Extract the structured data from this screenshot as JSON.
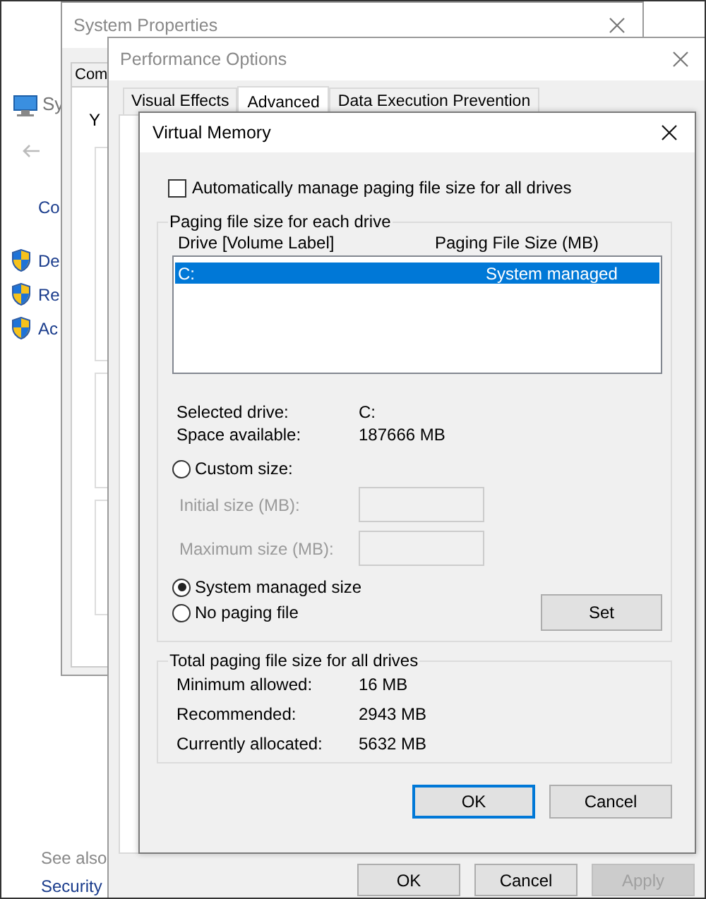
{
  "control_panel": {
    "header": "Sy",
    "link": "Co",
    "tasks": [
      {
        "label": "De"
      },
      {
        "label": "Re"
      },
      {
        "label": "Ac"
      }
    ],
    "see_also": "See also",
    "security": "Security"
  },
  "system_properties": {
    "title": "System Properties",
    "tab": "Com",
    "text": "Y"
  },
  "performance_options": {
    "title": "Performance Options",
    "tabs": [
      {
        "label": "Visual Effects",
        "selected": false
      },
      {
        "label": "Advanced",
        "selected": true
      },
      {
        "label": "Data Execution Prevention",
        "selected": false
      }
    ],
    "buttons": [
      {
        "label": "OK",
        "disabled": false
      },
      {
        "label": "Cancel",
        "disabled": false
      },
      {
        "label": "Apply",
        "disabled": true
      }
    ]
  },
  "virtual_memory": {
    "title": "Virtual Memory",
    "auto_manage": {
      "label": "Automatically manage paging file size for all drives",
      "checked": false
    },
    "drives_group": {
      "title": "Paging file size for each drive",
      "columns": [
        "Drive  [Volume Label]",
        "Paging File Size (MB)"
      ],
      "rows": [
        {
          "drive": "C:",
          "size": "System managed",
          "selected": true
        }
      ],
      "info": [
        {
          "label": "Selected drive:",
          "value": "C:"
        },
        {
          "label": "Space available:",
          "value": "187666 MB"
        }
      ],
      "custom": {
        "label": "Custom size:",
        "selected": false
      },
      "fields": [
        {
          "label": "Initial size (MB):",
          "disabled": true
        },
        {
          "label": "Maximum size (MB):",
          "disabled": true
        }
      ],
      "system_managed": {
        "label": "System managed size",
        "selected": true
      },
      "no_paging": {
        "label": "No paging file",
        "selected": false
      },
      "set_button": "Set"
    },
    "totals_group": {
      "title": "Total paging file size for all drives",
      "rows": [
        {
          "label": "Minimum allowed:",
          "value": "16 MB"
        },
        {
          "label": "Recommended:",
          "value": "2943 MB"
        },
        {
          "label": "Currently allocated:",
          "value": "5632 MB"
        }
      ]
    },
    "buttons": [
      {
        "label": "OK",
        "default": true
      },
      {
        "label": "Cancel",
        "default": false
      }
    ]
  }
}
